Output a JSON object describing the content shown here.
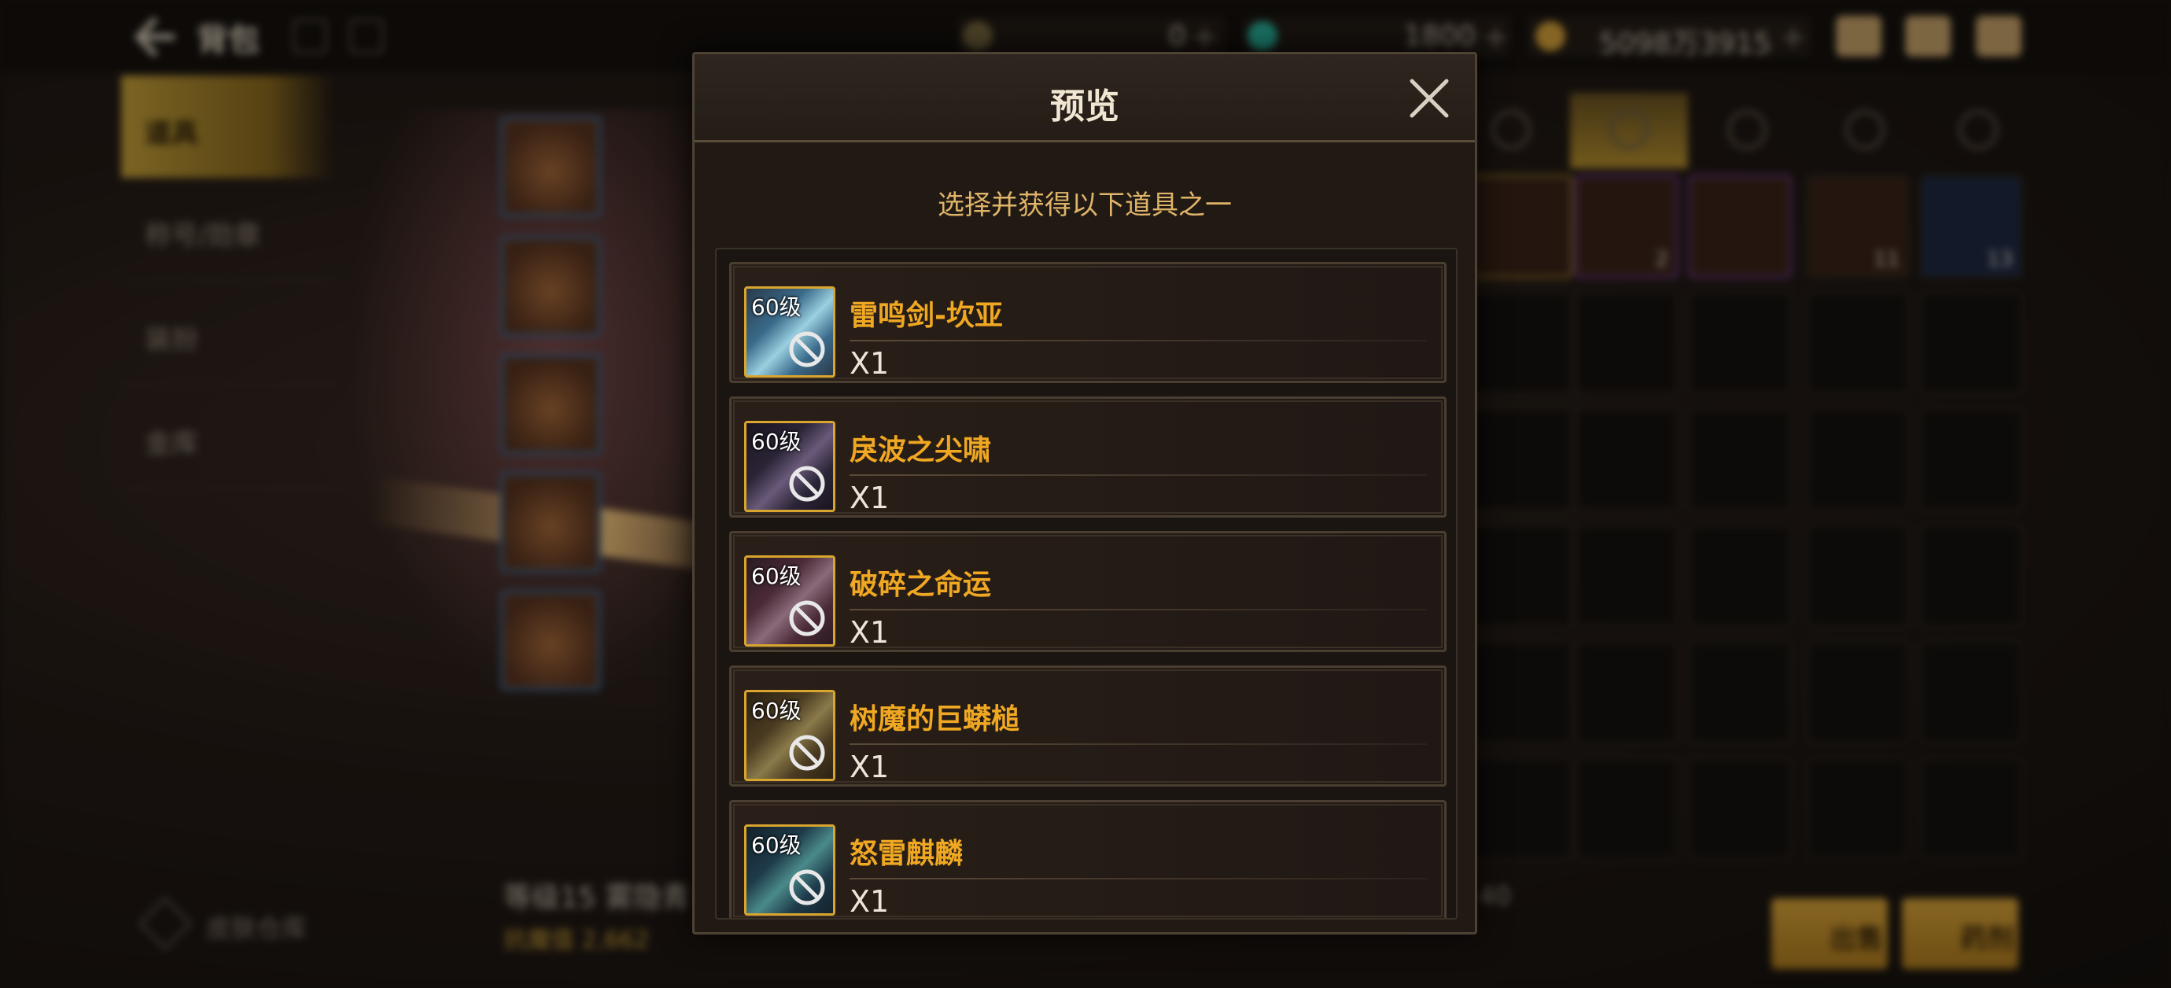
{
  "topbar": {
    "title": "背包",
    "currencies": [
      {
        "icon": "crescent-currency-icon",
        "value": "0"
      },
      {
        "icon": "gem-currency-icon",
        "value": "1800"
      },
      {
        "icon": "gold-coin-icon",
        "value": "5098万3915"
      }
    ],
    "plus": "+"
  },
  "sidebar": {
    "items": [
      {
        "label": "道具"
      },
      {
        "label": "称号/勋章"
      },
      {
        "label": "装扮"
      },
      {
        "label": "金库"
      }
    ],
    "skin_warehouse": "皮肤仓库"
  },
  "character": {
    "name": "等级15 雾隐青",
    "stat": "抗魔值 2,662"
  },
  "inventory": {
    "counts": [
      "2",
      "11",
      "13"
    ],
    "capacity": "40"
  },
  "actions": {
    "sell": "出售",
    "dismantle": "药剂"
  },
  "modal": {
    "title": "预览",
    "subtitle": "选择并获得以下道具之一",
    "items": [
      {
        "level": "60级",
        "name": "雷鸣剑-坎亚",
        "qty": "X1",
        "icon": "sword-icon",
        "colors": [
          "#3a6a8a",
          "#9ad0e0",
          "#2a3a4a"
        ]
      },
      {
        "level": "60级",
        "name": "戾波之尖啸",
        "qty": "X1",
        "icon": "dark-blade-icon",
        "colors": [
          "#2a2436",
          "#6a5a7a",
          "#1a1420"
        ]
      },
      {
        "level": "60级",
        "name": "破碎之命运",
        "qty": "X1",
        "icon": "gauntlet-icon",
        "colors": [
          "#4a2a36",
          "#8a6a7a",
          "#2a1a22"
        ]
      },
      {
        "level": "60级",
        "name": "树魔的巨蟒槌",
        "qty": "X1",
        "icon": "mace-icon",
        "colors": [
          "#4a3a20",
          "#8a7a4a",
          "#2a2214"
        ]
      },
      {
        "level": "60级",
        "name": "怒雷麒麟",
        "qty": "X1",
        "icon": "lightning-beast-icon",
        "colors": [
          "#1e3a4a",
          "#4a8a8a",
          "#14222a"
        ]
      }
    ]
  }
}
